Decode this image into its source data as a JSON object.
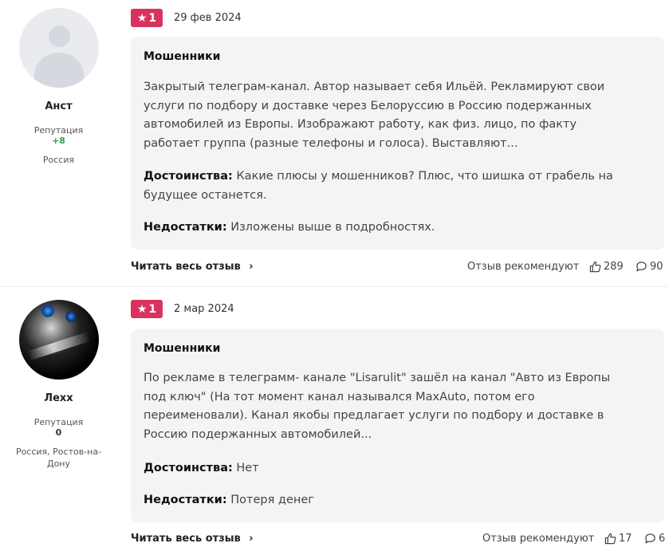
{
  "reviews": [
    {
      "author": {
        "name": "Анст",
        "rep_label": "Репутация",
        "rep_value": "+8",
        "location": "Россия"
      },
      "rating": "1",
      "date": "29 фев 2024",
      "title": "Мошенники",
      "text": "Закрытый телеграм-канал. Автор называет себя Ильёй. Рекламируют свои услуги по подбору и доставке через Белоруссию в Россию подержанных автомобилей из Европы. Изображают работу, как физ. лицо, по факту работает группа (разные телефоны и голоса). Выставляют...",
      "pros_label": "Достоинства:",
      "pros": "Какие плюсы у мошенников? Плюс, что шишка от грабель на будущее останется.",
      "cons_label": "Недостатки:",
      "cons": "Изложены выше в подробностях.",
      "read_more": "Читать весь отзыв",
      "recommend_label": "Отзыв рекомендуют",
      "likes": "289",
      "comments": "90"
    },
    {
      "author": {
        "name": "Лехх",
        "rep_label": "Репутация",
        "rep_value": "0",
        "location": "Россия, Ростов-на-Дону"
      },
      "rating": "1",
      "date": "2 мар 2024",
      "title": "Мошенники",
      "text": "По рекламе в телеграмм- канале \"Lisarulit\" зашёл на канал \"Авто из Европы под ключ\" (На тот момент канал назывался MaxAuto, потом его переименовали). Канал якобы предлагает услуги по подбору и доставке в Россию подержанных автомобилей...",
      "pros_label": "Достоинства:",
      "pros": "Нет",
      "cons_label": "Недостатки:",
      "cons": "Потеря денег",
      "read_more": "Читать весь отзыв",
      "recommend_label": "Отзыв рекомендуют",
      "likes": "17",
      "comments": "6"
    }
  ],
  "colors": {
    "badge": "#d8335e",
    "rep_positive": "#2ea043",
    "card_bg": "#f4f4f6"
  },
  "icons": [
    "star-icon",
    "thumbs-up-icon",
    "comment-icon",
    "chevron-right-icon",
    "default-avatar-icon"
  ]
}
